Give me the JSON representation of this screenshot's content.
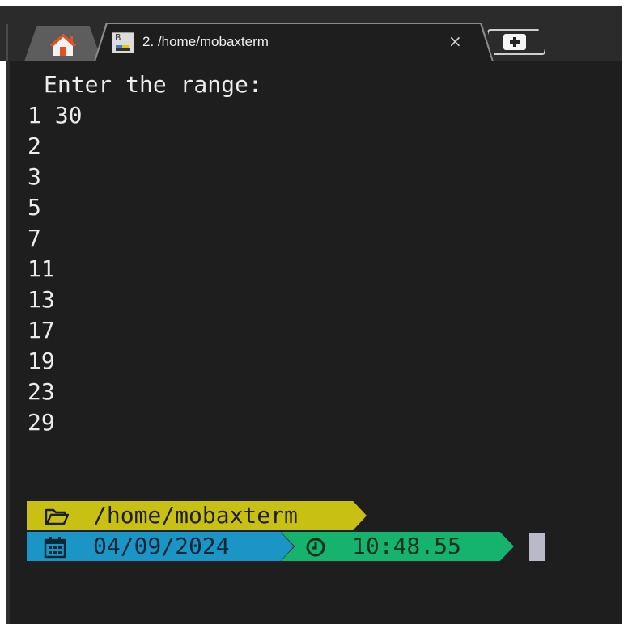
{
  "tabs": {
    "home_icon": "home-icon",
    "session": {
      "title": "2. /home/mobaxterm",
      "close_glyph": "×",
      "icon_letter": "B"
    },
    "new_tab_icon": "plus-icon"
  },
  "terminal": {
    "prompt_text": "Enter the range:",
    "input_line": "1 30",
    "output_lines": [
      "2",
      "3",
      "5",
      "7",
      "11",
      "13",
      "17",
      "19",
      "23",
      "29"
    ]
  },
  "prompt_bar": {
    "path": "/home/mobaxterm",
    "date": "04/09/2024",
    "time": "10:48.55",
    "colors": {
      "path_bg": "#c9c014",
      "date_bg": "#1b95c5",
      "time_bg": "#16b36e",
      "terminal_bg": "#1e1e1e"
    }
  }
}
